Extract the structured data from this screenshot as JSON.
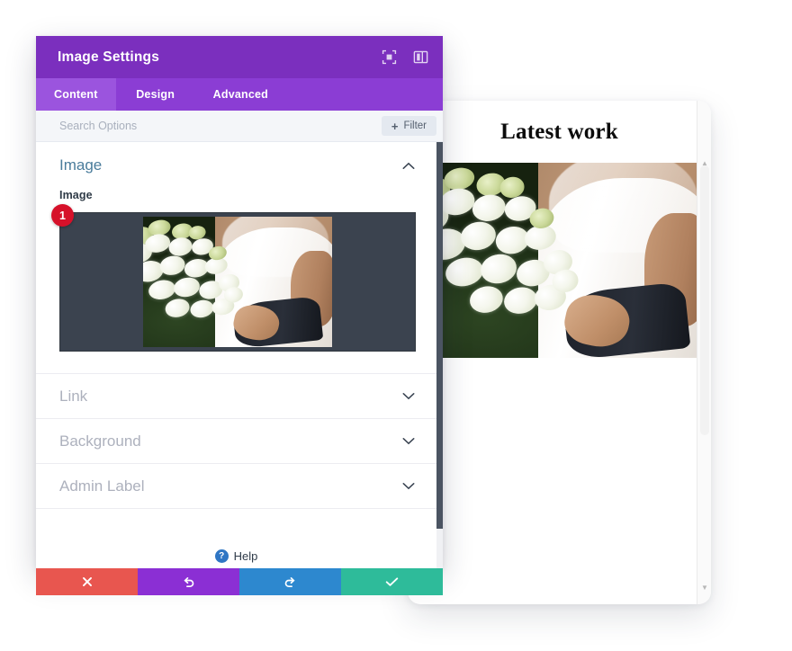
{
  "modal": {
    "title": "Image Settings",
    "header_icons": [
      {
        "name": "fullscreen-icon",
        "glyph": "expand"
      },
      {
        "name": "layout-columns-icon",
        "glyph": "columns"
      }
    ],
    "tabs": [
      {
        "label": "Content",
        "active": true
      },
      {
        "label": "Design",
        "active": false
      },
      {
        "label": "Advanced",
        "active": false
      }
    ],
    "search": {
      "placeholder": "Search Options",
      "value": ""
    },
    "filter_button": {
      "label": "Filter",
      "plus": "+"
    },
    "sections": [
      {
        "title": "Image",
        "expanded": true,
        "field_label": "Image",
        "badge": "1"
      },
      {
        "title": "Link",
        "expanded": false
      },
      {
        "title": "Background",
        "expanded": false
      },
      {
        "title": "Admin Label",
        "expanded": false
      }
    ],
    "help": {
      "icon": "?",
      "label": "Help"
    },
    "actions": [
      {
        "name": "cancel-button",
        "icon": "✖",
        "color": "#e8564f"
      },
      {
        "name": "undo-button",
        "icon": "↺",
        "color": "#8b2fd4"
      },
      {
        "name": "redo-button",
        "icon": "↻",
        "color": "#2d88cf"
      },
      {
        "name": "save-button",
        "icon": "✔",
        "color": "#2ebb9a"
      }
    ]
  },
  "preview": {
    "title": "Latest work",
    "image_alt": "bride holding white bouquet"
  },
  "colors": {
    "header_purple": "#7B2FBE",
    "tabbar_purple": "#8B3DD4",
    "tab_active_purple": "#9B54DE",
    "section_title_blue": "#4a7c9b",
    "section_title_muted": "#adb1bd",
    "badge_red": "#d6112a",
    "upload_bg": "#3b434f",
    "cancel_red": "#e8564f",
    "undo_purple": "#8b2fd4",
    "redo_blue": "#2d88cf",
    "save_green": "#2ebb9a"
  }
}
